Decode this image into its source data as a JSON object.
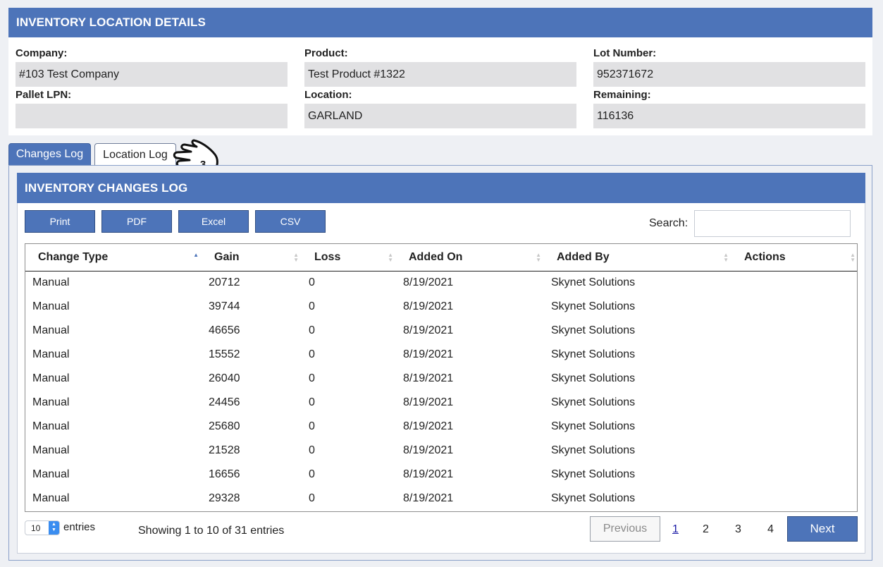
{
  "details": {
    "title": "INVENTORY LOCATION DETAILS",
    "fields": [
      {
        "label": "Company:",
        "value": "#103 Test Company"
      },
      {
        "label": "Product:",
        "value": "Test Product #1322"
      },
      {
        "label": "Lot Number:",
        "value": "952371672"
      },
      {
        "label": "Pallet LPN:",
        "value": ""
      },
      {
        "label": "Location:",
        "value": "GARLAND"
      },
      {
        "label": "Remaining:",
        "value": "116136"
      }
    ]
  },
  "tabs": [
    {
      "label": "Changes Log",
      "active": true
    },
    {
      "label": "Location Log",
      "active": false
    }
  ],
  "pointer": {
    "icon": "pointing-hand-icon",
    "badge": "3"
  },
  "log": {
    "title": "INVENTORY CHANGES LOG",
    "export_buttons": [
      "Print",
      "PDF",
      "Excel",
      "CSV"
    ],
    "search_label": "Search:",
    "search_value": "",
    "columns": [
      "Change Type",
      "Gain",
      "Loss",
      "Added On",
      "Added By",
      "Actions"
    ],
    "rows": [
      [
        "Manual",
        "20712",
        "0",
        "8/19/2021",
        "Skynet Solutions",
        ""
      ],
      [
        "Manual",
        "39744",
        "0",
        "8/19/2021",
        "Skynet Solutions",
        ""
      ],
      [
        "Manual",
        "46656",
        "0",
        "8/19/2021",
        "Skynet Solutions",
        ""
      ],
      [
        "Manual",
        "15552",
        "0",
        "8/19/2021",
        "Skynet Solutions",
        ""
      ],
      [
        "Manual",
        "26040",
        "0",
        "8/19/2021",
        "Skynet Solutions",
        ""
      ],
      [
        "Manual",
        "24456",
        "0",
        "8/19/2021",
        "Skynet Solutions",
        ""
      ],
      [
        "Manual",
        "25680",
        "0",
        "8/19/2021",
        "Skynet Solutions",
        ""
      ],
      [
        "Manual",
        "21528",
        "0",
        "8/19/2021",
        "Skynet Solutions",
        ""
      ],
      [
        "Manual",
        "16656",
        "0",
        "8/19/2021",
        "Skynet Solutions",
        ""
      ],
      [
        "Manual",
        "29328",
        "0",
        "8/19/2021",
        "Skynet Solutions",
        ""
      ]
    ],
    "entries_value": "10",
    "entries_label": "entries",
    "info": "Showing 1 to 10 of 31 entries",
    "pagination": {
      "previous": "Previous",
      "pages": [
        "1",
        "2",
        "3",
        "4"
      ],
      "current": "1",
      "next": "Next"
    }
  },
  "colors": {
    "accent": "#4d74b9",
    "background": "#eef0f4",
    "field_bg": "#e1e1e3"
  }
}
